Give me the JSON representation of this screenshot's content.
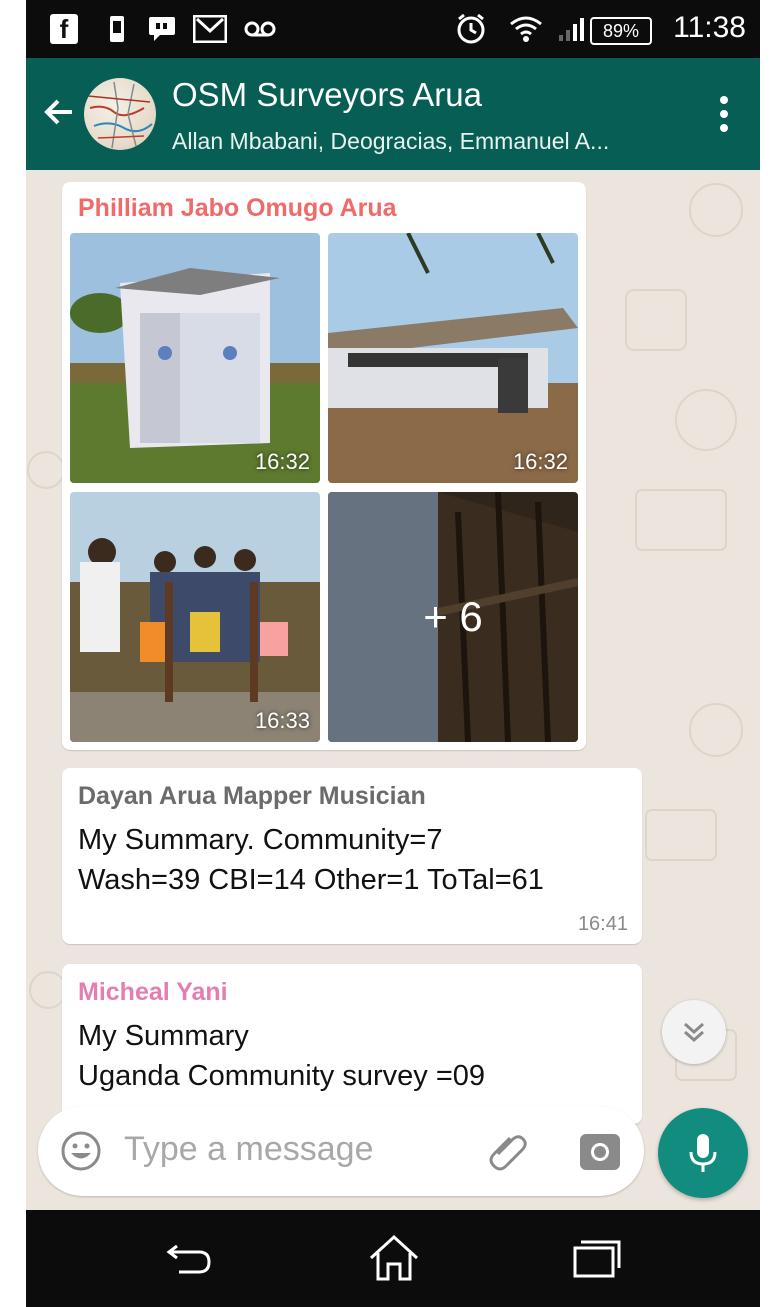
{
  "statusbar": {
    "battery": "89%",
    "time": "11:38",
    "icons": [
      "facebook-icon",
      "phone-icon",
      "message-icon",
      "gmail-icon",
      "voicemail-icon",
      "alarm-icon",
      "wifi-icon",
      "signal-icon",
      "battery-icon"
    ]
  },
  "appbar": {
    "title": "OSM Surveyors Arua",
    "subtitle": "Allan Mbabani, Deogracias, Emmanuel A..."
  },
  "messages": [
    {
      "sender": "Philliam Jabo Omugo Arua",
      "sender_color": "#f06a6a",
      "photos": [
        {
          "time": "16:32"
        },
        {
          "time": "16:32"
        },
        {
          "time": "16:33"
        },
        {
          "more": "+ 6"
        }
      ]
    },
    {
      "sender": "Dayan Arua Mapper Musician",
      "sender_color": "#6b6b6b",
      "lines": [
        "My Summary. Community=7",
        "Wash=39 CBI=14 Other=1 ToTal=61"
      ],
      "time": "16:41"
    },
    {
      "sender": "Micheal Yani",
      "sender_color": "#e47db0",
      "lines": [
        "My Summary",
        "Uganda Community survey =09"
      ]
    }
  ],
  "composer": {
    "placeholder": "Type a message"
  },
  "colors": {
    "header": "#075e54",
    "accent": "#128c7e",
    "chat_bg": "#ece5dd"
  }
}
